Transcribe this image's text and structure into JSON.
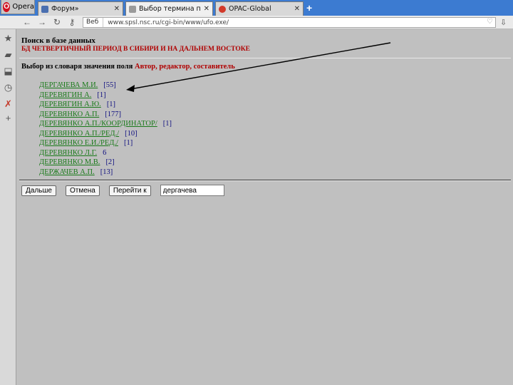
{
  "browser": {
    "menu_label": "Opera",
    "tabs": [
      {
        "label": "Форум»",
        "active": false,
        "icon": "forum-favicon"
      },
      {
        "label": "Выбор термина поиска",
        "active": true,
        "icon": "page-favicon"
      },
      {
        "label": "OPAC-Global",
        "active": false,
        "icon": "opac-favicon"
      }
    ],
    "address": {
      "site_label": "Веб",
      "url": "www.spsl.nsc.ru/cgi-bin/www/ufo.exe/"
    }
  },
  "page": {
    "heading": "Поиск в базе данных",
    "db_name": "БД ЧЕТВЕРТИЧНЫЙ ПЕРИОД В СИБИРИ И НА ДАЛЬНЕМ ВОСТОКЕ",
    "select_prefix": "Выбор из словаря значения поля",
    "select_field": "Автор, редактор, составитель",
    "entries": [
      {
        "name": "ДЕРГАЧЕВА М.И.",
        "count": "[55]"
      },
      {
        "name": "ДЕРЕВЯГИН А.",
        "count": "[1]"
      },
      {
        "name": "ДЕРЕВЯГИН А.Ю.",
        "count": "[1]"
      },
      {
        "name": "ДЕРЕВЯНКО А.П.",
        "count": "[177]"
      },
      {
        "name": "ДЕРЕВЯНКО А.П./КООРДИНАТОР/",
        "count": "[1]"
      },
      {
        "name": "ДЕРЕВЯНКО А.П./РЕД./",
        "count": "[10]"
      },
      {
        "name": "ДЕРЕВЯНКО Е.И./РЕД./",
        "count": "[1]"
      },
      {
        "name": "ДЕРЕВЯНКО Л.Г.",
        "count": "6"
      },
      {
        "name": "ДЕРЕВЯНКО М.В.",
        "count": "[2]"
      },
      {
        "name": "ДЕРЖАЧЕВ А.П.",
        "count": "[13]"
      }
    ],
    "buttons": {
      "next": "Дальше",
      "cancel": "Отмена",
      "goto": "Перейти к"
    },
    "goto_value": "дергачева"
  },
  "colors": {
    "page_bg": "#c0c0c0",
    "link": "#1a7a1a",
    "count": "#101080",
    "heading_red": "#b00000",
    "tabbar": "#3c7bd1"
  }
}
